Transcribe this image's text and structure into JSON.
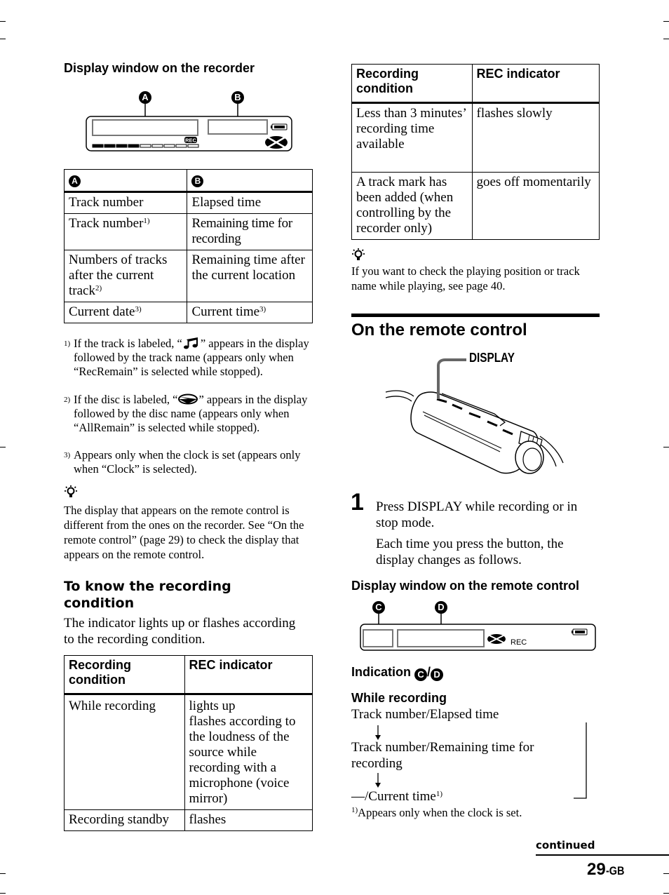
{
  "left": {
    "recorder_display_heading": "Display window on the recorder",
    "recorder_display": {
      "callout_a": "A",
      "callout_b": "B",
      "rec_label": "REC",
      "level_meter": {
        "filled_segments": 4,
        "total_segments": 9
      }
    },
    "display_table": {
      "header": [
        "A",
        "B"
      ],
      "rows": [
        {
          "a": "Track number",
          "a_sup": "",
          "b": "Elapsed time",
          "b_sup": ""
        },
        {
          "a": "Track number",
          "a_sup": "1)",
          "b": "Remaining time for recording",
          "b_sup": ""
        },
        {
          "a": "Numbers of tracks after the current track",
          "a_sup": "2)",
          "b": "Remaining time after the current location",
          "b_sup": ""
        },
        {
          "a": "Current date",
          "a_sup": "3)",
          "b": "Current time",
          "b_sup": "3)"
        }
      ]
    },
    "footnotes": [
      {
        "num": "1)",
        "before": "If the track is labeled, “",
        "icon": "music-note-icon",
        "after": "” appears in the display followed by the track name (appears only when “RecRemain” is selected while stopped)."
      },
      {
        "num": "2)",
        "before": "If the disc is labeled, “",
        "icon": "disc-icon",
        "after": "” appears in the display followed by the disc name (appears only when “AllRemain” is selected while stopped)."
      },
      {
        "num": "3)",
        "before": "Appears only when the clock is set (appears only when “Clock” is selected).",
        "icon": "",
        "after": ""
      }
    ],
    "tip_text": "The display that appears on the remote control is different from the ones on the recorder. See “On the remote control” (page 29) to check the display that appears on the remote control.",
    "recording_condition_heading": "To know the recording condition",
    "recording_condition_intro": "The indicator lights up or flashes according to the recording condition.",
    "rec_table": {
      "header": [
        "Recording condition",
        "REC indicator"
      ],
      "rows": [
        {
          "condition": "While recording",
          "indicator": "lights up\nflashes according to the loudness of the source while recording with a microphone (voice mirror)"
        },
        {
          "condition": "Recording standby",
          "indicator": "flashes"
        }
      ]
    }
  },
  "right": {
    "rec_table": {
      "header": [
        "Recording condition",
        "REC indicator"
      ],
      "rows": [
        {
          "condition": "Less than 3 minutes’ recording time available",
          "indicator": "flashes slowly"
        },
        {
          "condition": "A track mark has been added (when controlling by the recorder only)",
          "indicator": "goes off momentarily"
        }
      ]
    },
    "tip_text": "If you want to check the playing position or track name while playing, see page 40.",
    "section_title": "On the remote control",
    "remote_illustration": {
      "display_label": "DISPLAY"
    },
    "step": {
      "number": "1",
      "line1": "Press DISPLAY while recording or in stop mode.",
      "line2": "Each time you press the button, the display changes as follows."
    },
    "remote_display_heading": "Display window on the remote control",
    "remote_display": {
      "callout_c": "C",
      "callout_d": "D",
      "rec_label": "REC"
    },
    "indication_heading": "Indication",
    "indication_c": "C",
    "indication_sep": "/",
    "indication_d": "D",
    "while_recording_heading": "While recording",
    "sequence": [
      {
        "text": "Track number/Elapsed time",
        "sup": ""
      },
      {
        "text": "Track number/Remaining time for recording",
        "sup": ""
      },
      {
        "text": "—/Current time",
        "sup": "1)"
      }
    ],
    "sequence_footnote_num": "1)",
    "sequence_footnote": "Appears only when the clock is set."
  },
  "footer": {
    "continued": "continued",
    "page_number": "29",
    "page_suffix": "-GB"
  }
}
